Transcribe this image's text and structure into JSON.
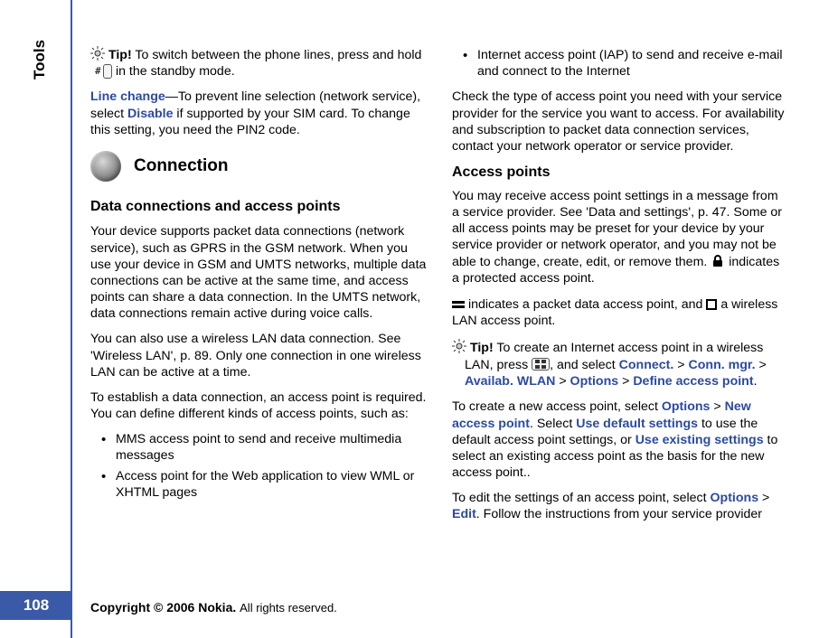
{
  "sidebar": {
    "section": "Tools",
    "page_number": "108"
  },
  "left": {
    "tip1_label": "Tip!",
    "tip1_text_a": " To switch between the phone lines, press and hold ",
    "tip1_key": "#",
    "tip1_text_b": " in the standby mode.",
    "line_change_label": "Line change",
    "line_change_text_a": "—To prevent line selection (network service), select ",
    "line_change_disable": "Disable",
    "line_change_text_b": " if supported by your SIM card. To change this setting, you need the PIN2 code.",
    "connection_heading": "Connection",
    "sub_heading": "Data connections and access points",
    "p1": "Your device supports packet data connections (network service), such as GPRS in the GSM network. When you use your device in GSM and UMTS networks, multiple data connections can be active at the same time, and access points can share a data connection. In the UMTS network, data connections remain active during voice calls.",
    "p2": "You can also use a wireless LAN data connection. See 'Wireless LAN', p. 89. Only one connection in one wireless LAN can be active at a time.",
    "p3": "To establish a data connection, an access point is required. You can define different kinds of access points, such as:",
    "bullets": [
      "MMS access point to send and receive multimedia messages",
      "Access point for the Web application to view WML or XHTML pages"
    ]
  },
  "right": {
    "bullet3": "Internet access point (IAP) to send and receive e-mail and connect to the Internet",
    "p1": "Check the type of access point you need with your service provider for the service you want to access. For availability and subscription to packet data connection services, contact your network operator or service provider.",
    "sub_heading": "Access points",
    "p2_a": "You may receive access point settings in a message from a service provider. See 'Data and settings', p. 47. Some or all access points may be preset for your device by your service provider or network operator, and you may not be able to change, create, edit, or remove them. ",
    "p2_b": " indicates a protected access point.",
    "p3_a": " indicates a packet data access point, and ",
    "p3_b": " a wireless LAN access point.",
    "tip2_label": "Tip!",
    "tip2_text_a": " To create an Internet access point in a wireless LAN, press ",
    "tip2_text_b": ", and select ",
    "tip2_connect": "Connect.",
    "tip2_gt1": " > ",
    "tip2_connmgr": "Conn. mgr.",
    "tip2_gt2": " > ",
    "tip2_availab": "Availab. WLAN",
    "tip2_gt3": " > ",
    "tip2_options": "Options",
    "tip2_gt4": " > ",
    "tip2_define": "Define access point",
    "tip2_period": ".",
    "p4_a": "To create a new access point, select ",
    "p4_options": "Options",
    "p4_gt": " > ",
    "p4_newap": "New access point",
    "p4_b": ". Select ",
    "p4_usedef": "Use default settings",
    "p4_c": " to use the default access point settings, or ",
    "p4_useexist": "Use existing settings",
    "p4_d": " to select an existing access point as the basis for the new access point..",
    "p5_a": "To edit the settings of an access point, select ",
    "p5_options": "Options",
    "p5_gt": " > ",
    "p5_edit": "Edit",
    "p5_b": ". Follow the instructions from your service provider"
  },
  "footer": {
    "copyright_bold": "Copyright © 2006 Nokia. ",
    "copyright_rest": "All rights reserved."
  }
}
